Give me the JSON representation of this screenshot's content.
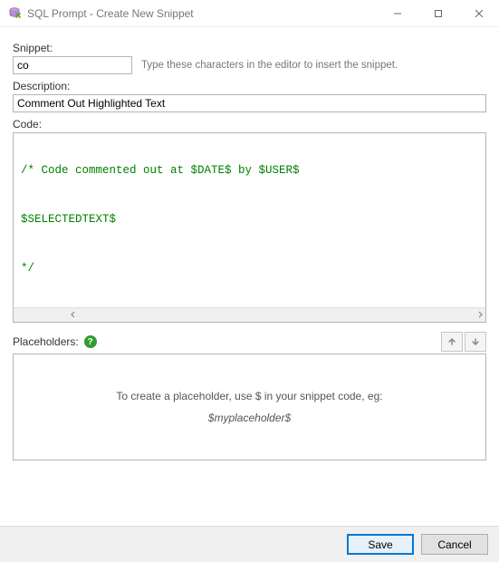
{
  "window": {
    "title": "SQL Prompt - Create New Snippet"
  },
  "labels": {
    "snippet": "Snippet:",
    "snippet_hint": "Type these characters in the editor to insert the snippet.",
    "description": "Description:",
    "code": "Code:",
    "placeholders": "Placeholders:",
    "ph_hint": "To create a placeholder, use $ in your snippet code, eg:",
    "ph_example": "$myplaceholder$"
  },
  "fields": {
    "snippet_value": "co",
    "description_value": "Comment Out Highlighted Text"
  },
  "code": {
    "line1": "/* Code commented out at $DATE$ by $USER$",
    "line2": "$SELECTEDTEXT$",
    "line3": "*/"
  },
  "buttons": {
    "save": "Save",
    "cancel": "Cancel"
  }
}
